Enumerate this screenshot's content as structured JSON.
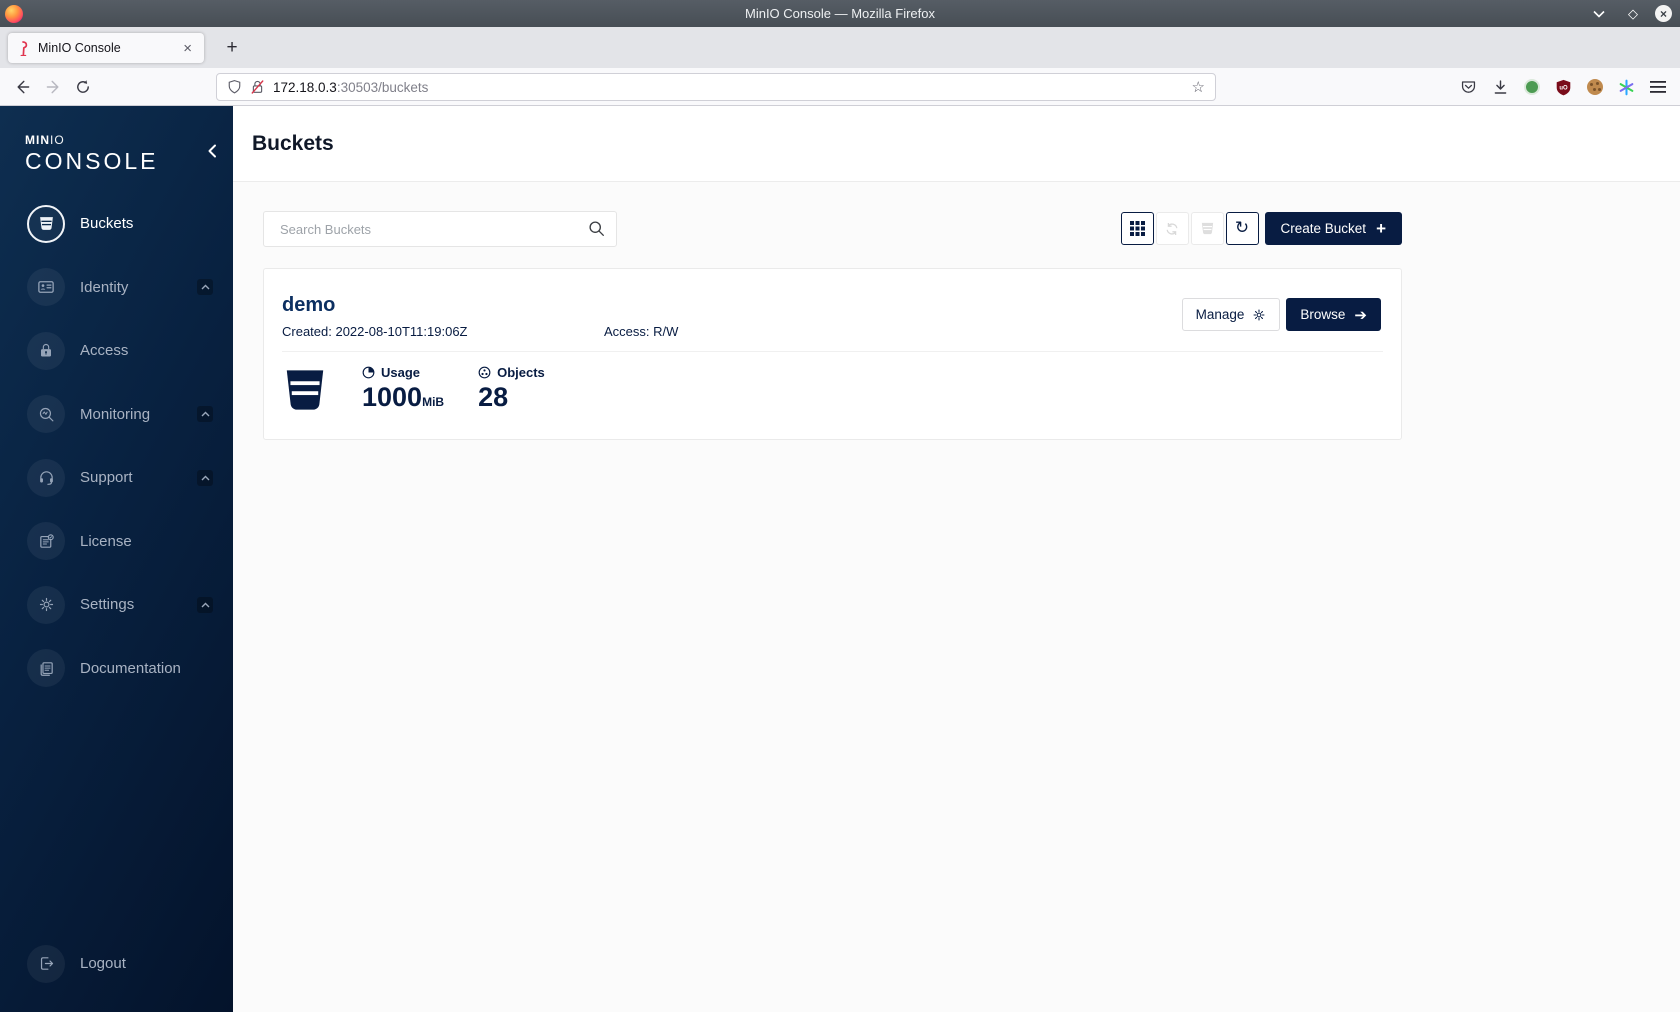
{
  "window": {
    "title": "MinIO Console — Mozilla Firefox"
  },
  "browser": {
    "tab_title": "MinIO Console",
    "url_host": "172.18.0.3",
    "url_rest": ":30503/buckets"
  },
  "icons": {
    "new_tab": "+",
    "close_tab": "×",
    "star": "☆",
    "maximize": "◇",
    "close_window": "×",
    "refresh": "↻",
    "plus": "+",
    "arrow_right": "➔"
  },
  "colors": {
    "brand_navy": "#081C42",
    "sidebar_gradient_start": "#0e2e50",
    "sidebar_gradient_end": "#04132b",
    "content_bg": "#fbfbfb"
  },
  "sidebar": {
    "logo": {
      "brand_bold": "MIN",
      "brand_light": "IO",
      "product": "CONSOLE"
    },
    "items": [
      {
        "label": "Buckets",
        "active": true
      },
      {
        "label": "Identity",
        "expandable": true
      },
      {
        "label": "Access"
      },
      {
        "label": "Monitoring",
        "expandable": true
      },
      {
        "label": "Support",
        "expandable": true
      },
      {
        "label": "License"
      },
      {
        "label": "Settings",
        "expandable": true
      },
      {
        "label": "Documentation"
      }
    ],
    "logout_label": "Logout"
  },
  "page": {
    "title": "Buckets"
  },
  "actions": {
    "search_placeholder": "Search Buckets",
    "create_label": "Create Bucket"
  },
  "bucket": {
    "name": "demo",
    "created_label": "Created: 2022-08-10T11:19:06Z",
    "access_label": "Access: R/W",
    "usage_label": "Usage",
    "usage_value": "1000",
    "usage_unit": "MiB",
    "objects_label": "Objects",
    "objects_value": "28",
    "manage_label": "Manage",
    "browse_label": "Browse"
  }
}
